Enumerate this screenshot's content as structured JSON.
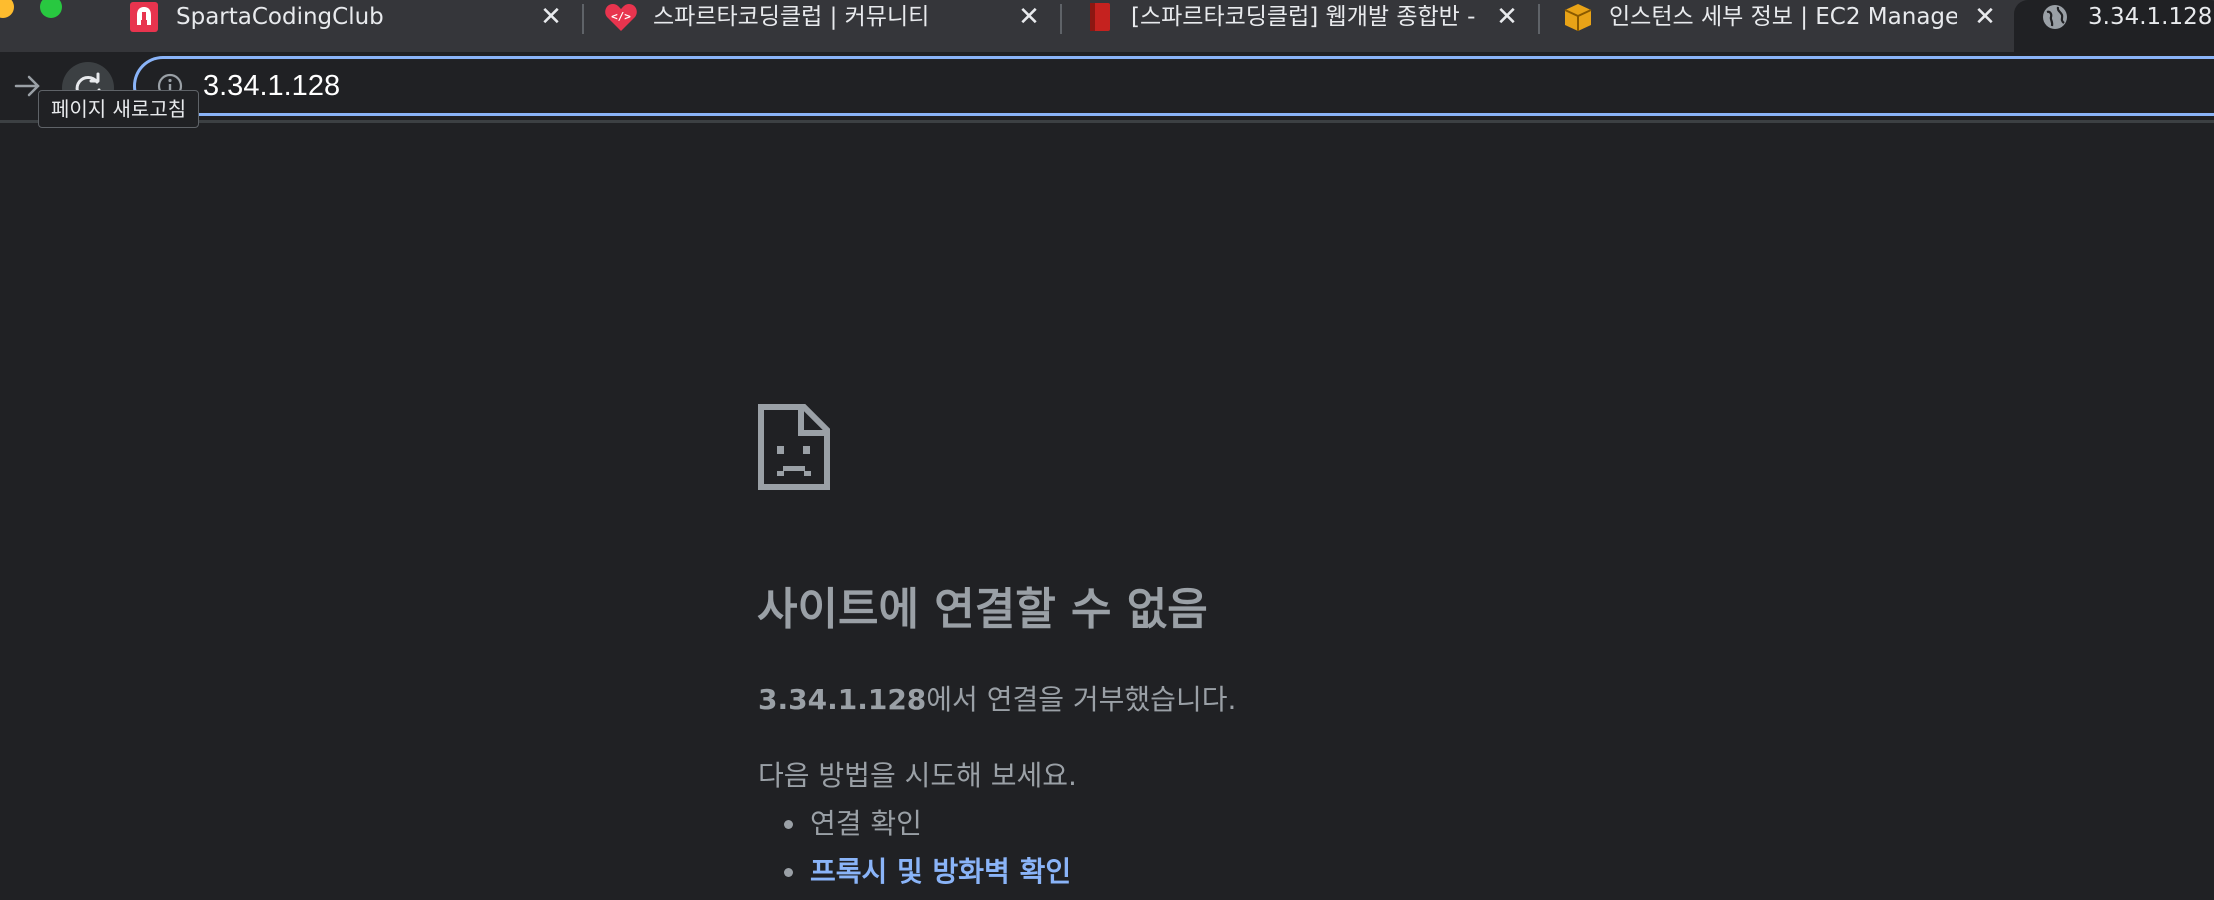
{
  "tabs": [
    {
      "title": "SpartaCodingClub",
      "favicon": "sparta-helmet-icon"
    },
    {
      "title": "스파르타코딩클럽 | 커뮤니티",
      "favicon": "code-heart-icon"
    },
    {
      "title": "[스파르타코딩클럽] 웹개발 종합반 -",
      "favicon": "red-book-icon"
    },
    {
      "title": "인스턴스 세부 정보 | EC2 Manager",
      "favicon": "box-icon"
    },
    {
      "title": "3.34.1.128",
      "favicon": "globe-icon"
    }
  ],
  "toolbar": {
    "url": "3.34.1.128",
    "reload_tooltip": "페이지 새로고침"
  },
  "error": {
    "title": "사이트에 연결할 수 없음",
    "host": "3.34.1.128",
    "message_suffix": "에서 연결을 거부했습니다.",
    "suggest_heading": "다음 방법을 시도해 보세요.",
    "suggestions": [
      "연결 확인",
      "프록시 및 방화벽 확인"
    ]
  },
  "colors": {
    "tab_strip": "#35363a",
    "page_background": "#202124",
    "focus_ring": "#8ab4f8",
    "muted_text": "#9aa0a6",
    "link": "#8ab4f8"
  }
}
